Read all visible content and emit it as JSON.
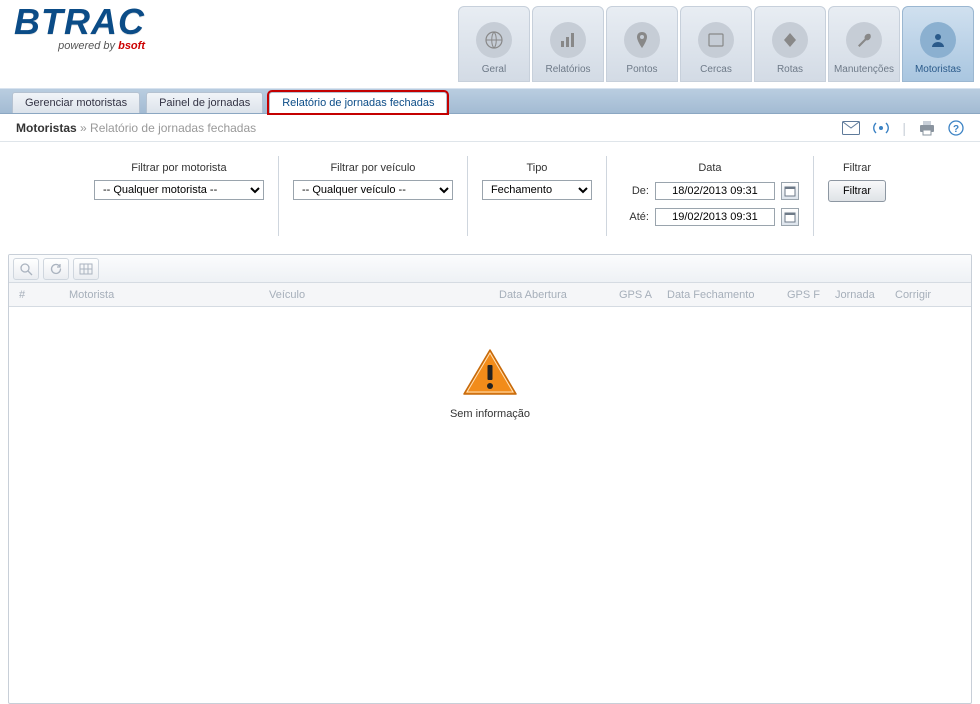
{
  "logo": {
    "word": "BTRAC",
    "powered_prefix": "powered by ",
    "powered_brand": "bsoft"
  },
  "nav": {
    "items": [
      {
        "label": "Geral",
        "icon": "globe"
      },
      {
        "label": "Relatórios",
        "icon": "chart"
      },
      {
        "label": "Pontos",
        "icon": "pin"
      },
      {
        "label": "Cercas",
        "icon": "fence"
      },
      {
        "label": "Rotas",
        "icon": "route"
      },
      {
        "label": "Manutenções",
        "icon": "wrench"
      },
      {
        "label": "Motoristas",
        "icon": "driver",
        "active": true
      }
    ]
  },
  "subtabs": {
    "items": [
      {
        "label": "Gerenciar motoristas"
      },
      {
        "label": "Painel de jornadas"
      },
      {
        "label": "Relatório de jornadas fechadas",
        "active": true
      }
    ]
  },
  "breadcrumb": {
    "root": "Motoristas",
    "sep": " » ",
    "current": "Relatório de jornadas fechadas"
  },
  "tools": {
    "mail": "mail-icon",
    "signal": "signal-icon",
    "print": "print-icon",
    "help": "help-icon"
  },
  "filters": {
    "motorista_lbl": "Filtrar por motorista",
    "motorista_sel": "-- Qualquer motorista --",
    "veiculo_lbl": "Filtrar por veículo",
    "veiculo_sel": "-- Qualquer veículo --",
    "tipo_lbl": "Tipo",
    "tipo_sel": "Fechamento",
    "data_lbl": "Data",
    "de_lbl": "De:",
    "ate_lbl": "Até:",
    "de_val": "18/02/2013 09:31",
    "ate_val": "19/02/2013 09:31",
    "filtrar_lbl": "Filtrar",
    "filtrar_btn": "Filtrar"
  },
  "grid": {
    "cols": {
      "num": "#",
      "motorista": "Motorista",
      "veiculo": "Veículo",
      "data_abertura": "Data Abertura",
      "gps_a": "GPS A",
      "data_fechamento": "Data Fechamento",
      "gps_f": "GPS F",
      "jornada": "Jornada",
      "corrigir": "Corrigir"
    },
    "empty_msg": "Sem informação"
  }
}
